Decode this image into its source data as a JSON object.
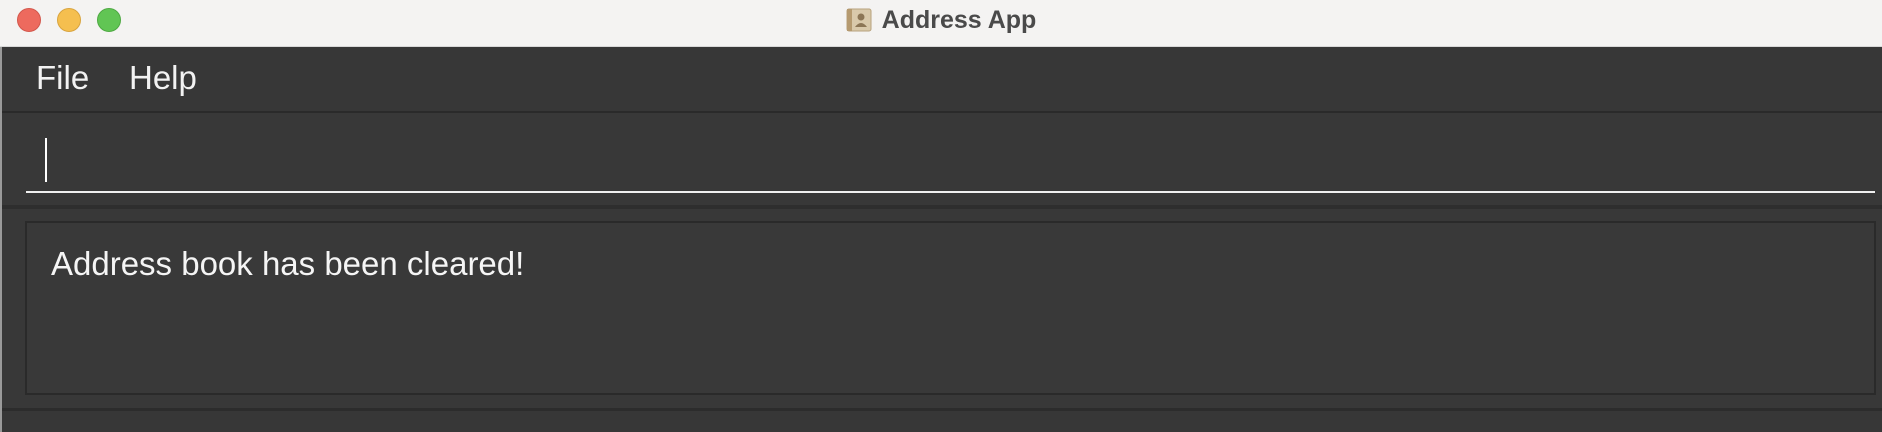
{
  "window": {
    "title": "Address App",
    "app_icon": "address-book-icon"
  },
  "menu": {
    "items": [
      {
        "label": "File"
      },
      {
        "label": "Help"
      }
    ]
  },
  "command_box": {
    "value": "",
    "placeholder": ""
  },
  "result_display": {
    "message": "Address book has been cleared!"
  },
  "colors": {
    "background": "#383838",
    "text": "#f5f5f5",
    "titlebar": "#f4f3f2",
    "close": "#ed6a5e",
    "minimize": "#f5bf4f",
    "maximize": "#61c554"
  }
}
